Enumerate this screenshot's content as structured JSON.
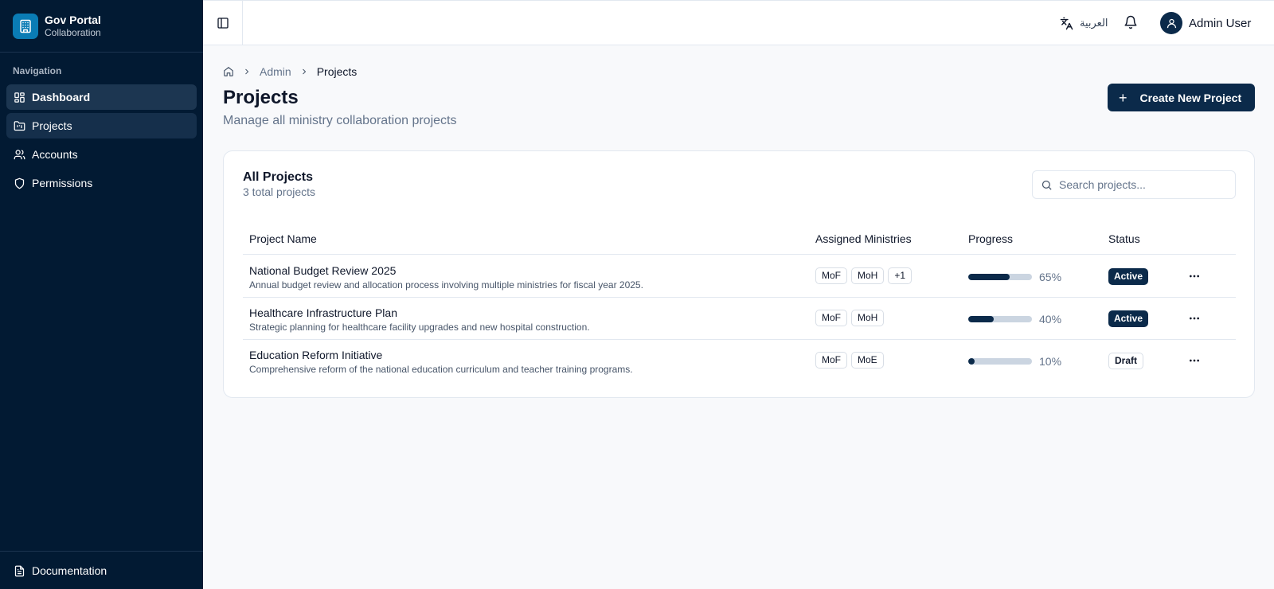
{
  "brand": {
    "title": "Gov Portal",
    "subtitle": "Collaboration",
    "logo_icon": "building-icon"
  },
  "sidebar": {
    "heading": "Navigation",
    "items": [
      {
        "label": "Dashboard",
        "icon": "dashboard-icon"
      },
      {
        "label": "Projects",
        "icon": "projects-icon"
      },
      {
        "label": "Accounts",
        "icon": "users-icon"
      },
      {
        "label": "Permissions",
        "icon": "shield-icon"
      }
    ],
    "footer": {
      "label": "Documentation",
      "icon": "document-icon"
    }
  },
  "topbar": {
    "language_label": "العربية",
    "user_name": "Admin User"
  },
  "breadcrumb": {
    "items": [
      "Admin",
      "Projects"
    ]
  },
  "page": {
    "title": "Projects",
    "subtitle": "Manage all ministry collaboration projects",
    "create_button": "Create New Project"
  },
  "card": {
    "title": "All Projects",
    "subtitle": "3 total projects",
    "search_placeholder": "Search projects..."
  },
  "table": {
    "columns": [
      "Project Name",
      "Assigned Ministries",
      "Progress",
      "Status"
    ],
    "rows": [
      {
        "name": "National Budget Review 2025",
        "description": "Annual budget review and allocation process involving multiple ministries for fiscal year 2025.",
        "ministries": [
          "MoF",
          "MoH",
          "+1"
        ],
        "progress": 65,
        "progress_label": "65%",
        "status": "Active"
      },
      {
        "name": "Healthcare Infrastructure Plan",
        "description": "Strategic planning for healthcare facility upgrades and new hospital construction.",
        "ministries": [
          "MoF",
          "MoH"
        ],
        "progress": 40,
        "progress_label": "40%",
        "status": "Active"
      },
      {
        "name": "Education Reform Initiative",
        "description": "Comprehensive reform of the national education curriculum and teacher training programs.",
        "ministries": [
          "MoF",
          "MoE"
        ],
        "progress": 10,
        "progress_label": "10%",
        "status": "Draft"
      }
    ]
  },
  "colors": {
    "sidebar_bg": "#021a33",
    "accent": "#0b2a4a",
    "brand_logo": "#0a7cb5"
  }
}
